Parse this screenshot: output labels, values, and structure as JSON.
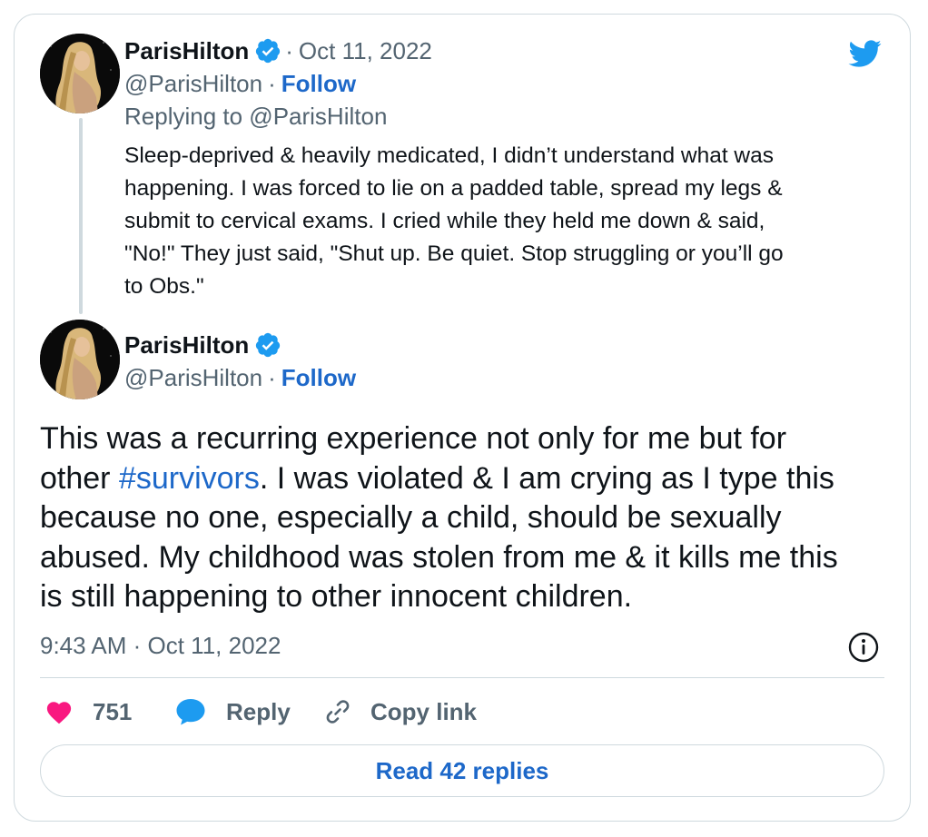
{
  "reply_tweet": {
    "display_name": "ParisHilton",
    "handle": "@ParisHilton",
    "date": "Oct 11, 2022",
    "follow_label": "Follow",
    "replying_to": "Replying to @ParisHilton",
    "text_lines": [
      "Sleep-deprived & heavily medicated, I didn’t understand what was",
      "happening. I was forced to lie on a padded table, spread my legs &",
      "submit to cervical exams. I cried while they held me down & said,",
      "\"No!\" They just said, \"Shut up. Be quiet. Stop struggling or you’ll go",
      "to Obs.\""
    ]
  },
  "main_tweet": {
    "display_name": "ParisHilton",
    "handle": "@ParisHilton",
    "follow_label": "Follow",
    "text": {
      "line1": "This was a recurring experience not only for me but for",
      "line2_before": "other ",
      "hashtag": "#survivors",
      "line2_after": ". I was violated & I am crying as I type this",
      "line3": "because no one, especially a child, should be sexually",
      "line4": "abused. My childhood was stolen from me & it kills me this",
      "line5": "is still happening to other innocent children."
    },
    "timestamp": "9:43 AM · Oct 11, 2022"
  },
  "actions": {
    "like_count": "751",
    "reply_label": "Reply",
    "copy_link_label": "Copy link"
  },
  "read_replies_label": "Read 42 replies",
  "separator": "·",
  "icons": {
    "brand": "twitter-bird-icon",
    "verified": "verified-badge-icon",
    "like": "heart-icon",
    "reply": "speech-bubble-icon",
    "copy_link": "link-icon",
    "info": "info-icon"
  },
  "colors": {
    "link_blue": "#1d68c9",
    "twitter_blue": "#1d9bf0",
    "like_pink": "#f91880",
    "muted_text": "#536471",
    "border": "#cfd9de"
  }
}
